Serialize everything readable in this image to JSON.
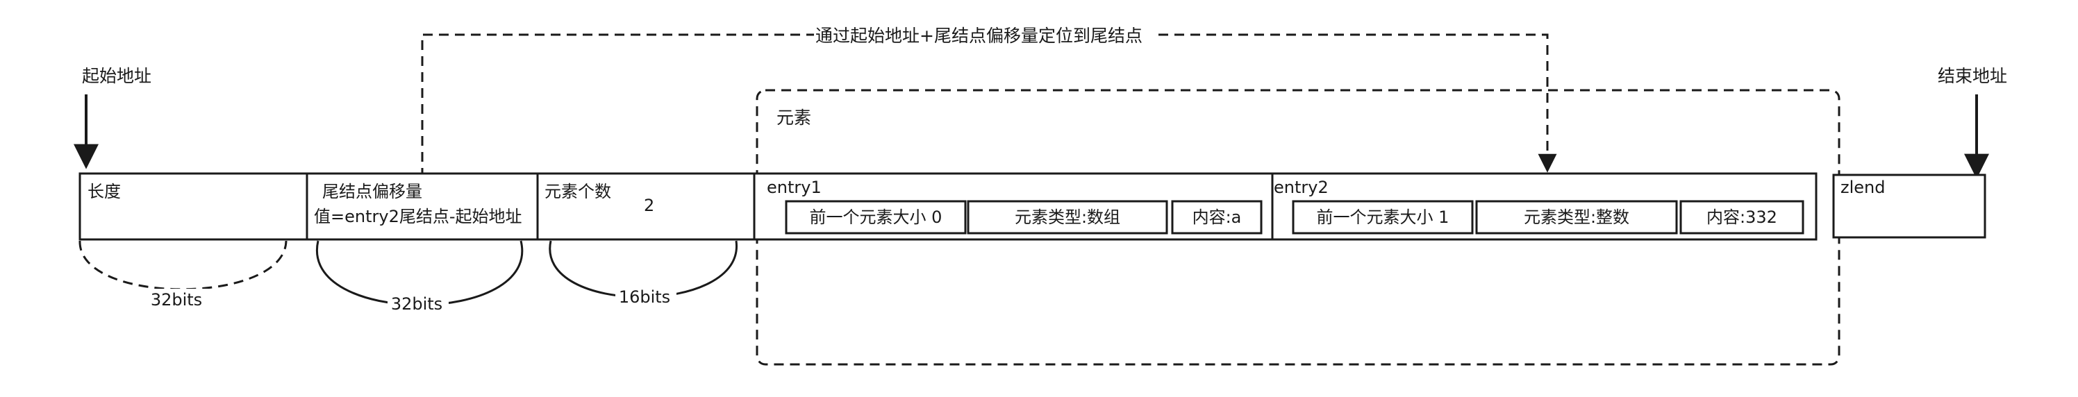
{
  "labels": {
    "start_addr": "起始地址",
    "end_addr": "结束地址",
    "locate": "通过起始地址+尾结点偏移量定位到尾结点",
    "elements": "元素"
  },
  "header": {
    "length": "长度",
    "tail_offset_title": "尾结点偏移量",
    "tail_offset_value": "值=entry2尾结点-起始地址",
    "count_title": "元素个数",
    "count_value": "2"
  },
  "entries": [
    {
      "name": "entry1",
      "prev_len": "前一个元素大小 0",
      "type": "元素类型:数组",
      "content": "内容:a"
    },
    {
      "name": "entry2",
      "prev_len": "前一个元素大小 1",
      "type": "元素类型:整数",
      "content": "内容:332"
    }
  ],
  "zlend": "zlend",
  "bits": {
    "length": "32bits",
    "tail_offset": "32bits",
    "count": "16bits"
  }
}
